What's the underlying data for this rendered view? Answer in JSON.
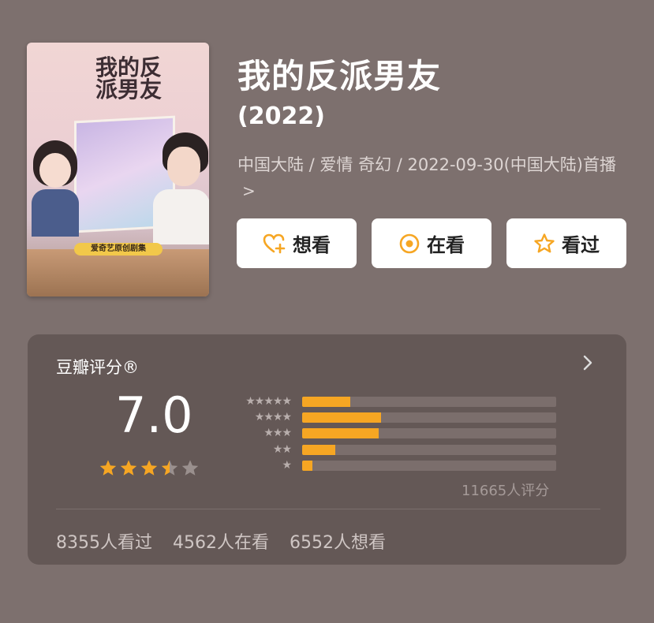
{
  "poster": {
    "title_text": "我的反派男友",
    "badge_text": "爱奇艺原创剧集"
  },
  "movie": {
    "title": "我的反派男友",
    "year": "(2022)",
    "meta": "中国大陆 / 爱情 奇幻 / 2022-09-30(中国大陆)首播",
    "meta_chevron": ">"
  },
  "actions": {
    "want_label": "想看",
    "watching_label": "在看",
    "watched_label": "看过"
  },
  "rating": {
    "label": "豆瓣评分®",
    "score": "7.0",
    "star_count": 3.5,
    "rater_count": "11665人评分",
    "distribution": [
      {
        "stars": "★★★★★",
        "percent": 19
      },
      {
        "stars": "★★★★",
        "percent": 31
      },
      {
        "stars": "★★★",
        "percent": 30
      },
      {
        "stars": "★★",
        "percent": 13
      },
      {
        "stars": "★",
        "percent": 4
      }
    ],
    "stats": {
      "watched": "8355人看过",
      "watching": "4562人在看",
      "want": "6552人想看"
    }
  },
  "colors": {
    "accent": "#f6a623",
    "background": "#7d706e",
    "card": "#645856"
  }
}
